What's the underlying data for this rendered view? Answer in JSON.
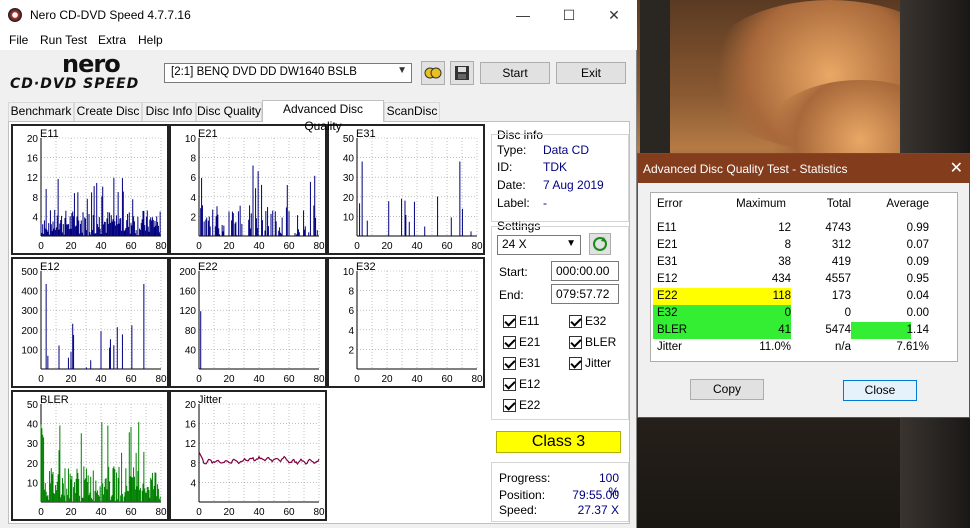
{
  "window": {
    "title": "Nero CD-DVD Speed 4.7.7.16",
    "minimize": "—",
    "maximize": "☐",
    "close": "✕"
  },
  "menu": [
    "File",
    "Run Test",
    "Extra",
    "Help"
  ],
  "logo": {
    "line1": "nero",
    "line2": "CD·DVD SPEED"
  },
  "toolbar": {
    "drive": "[2:1]   BENQ DVD DD DW1640 BSLB",
    "start": "Start",
    "exit": "Exit"
  },
  "tabs": [
    "Benchmark",
    "Create Disc",
    "Disc Info",
    "Disc Quality",
    "Advanced Disc Quality",
    "ScanDisc"
  ],
  "active_tab": "Advanced Disc Quality",
  "disc_info": {
    "header": "Disc info",
    "type_label": "Type:",
    "type": "Data CD",
    "id_label": "ID:",
    "id": "TDK",
    "date_label": "Date:",
    "date": "7 Aug 2019",
    "label_label": "Label:",
    "label": "-"
  },
  "settings": {
    "header": "Settings",
    "speed": "24 X",
    "start_label": "Start:",
    "start": "000:00.00",
    "end_label": "End:",
    "end": "079:57.72"
  },
  "checks": {
    "e11": "E11",
    "e21": "E21",
    "e31": "E31",
    "e12": "E12",
    "e22": "E22",
    "e32": "E32",
    "bler": "BLER",
    "jitter": "Jitter"
  },
  "class": "Class 3",
  "progress": {
    "progress_label": "Progress:",
    "progress": "100 %",
    "position_label": "Position:",
    "position": "79:55.00",
    "speed_label": "Speed:",
    "speed": "27.37 X"
  },
  "colors": {
    "e_series": "#000080",
    "e32_series": "#000080",
    "bler": "#008000",
    "jitter": "#800040",
    "highlight_yellow": "#ffff00",
    "highlight_green": "#33ee33"
  },
  "chart_data": [
    {
      "type": "bar",
      "name": "E11",
      "x": [
        0,
        20,
        40,
        60,
        80
      ],
      "yticks": [
        4,
        8,
        12,
        16,
        20
      ],
      "ylim": [
        0,
        20
      ],
      "color": "#000080",
      "shape": "dense_noise",
      "max": 12
    },
    {
      "type": "bar",
      "name": "E21",
      "x": [
        0,
        20,
        40,
        60,
        80
      ],
      "yticks": [
        2,
        4,
        6,
        8,
        10
      ],
      "ylim": [
        0,
        10
      ],
      "color": "#000080",
      "shape": "sparse",
      "max": 8
    },
    {
      "type": "bar",
      "name": "E31",
      "x": [
        0,
        20,
        40,
        60,
        80
      ],
      "yticks": [
        10,
        20,
        30,
        40,
        50
      ],
      "ylim": [
        0,
        50
      ],
      "color": "#000080",
      "shape": "rare",
      "max": 38
    },
    {
      "type": "bar",
      "name": "E12",
      "x": [
        0,
        20,
        40,
        60,
        80
      ],
      "yticks": [
        100,
        200,
        300,
        400,
        500
      ],
      "ylim": [
        0,
        500
      ],
      "color": "#000080",
      "shape": "rare",
      "max": 434
    },
    {
      "type": "bar",
      "name": "E22",
      "x": [
        0,
        20,
        40,
        60,
        80
      ],
      "yticks": [
        40,
        80,
        120,
        160,
        200
      ],
      "ylim": [
        0,
        200
      ],
      "color": "#000080",
      "shape": "single",
      "max": 118
    },
    {
      "type": "bar",
      "name": "E32",
      "x": [
        0,
        20,
        40,
        60,
        80
      ],
      "yticks": [
        2,
        4,
        6,
        8,
        10
      ],
      "ylim": [
        0,
        10
      ],
      "color": "#000080",
      "shape": "none",
      "max": 0
    },
    {
      "type": "bar",
      "name": "BLER",
      "x": [
        0,
        20,
        40,
        60,
        80
      ],
      "yticks": [
        10,
        20,
        30,
        40,
        50
      ],
      "ylim": [
        0,
        50
      ],
      "color": "#008000",
      "shape": "dense_noise",
      "max": 41
    },
    {
      "type": "line",
      "name": "Jitter",
      "x": [
        0,
        20,
        40,
        60,
        80
      ],
      "yticks": [
        4,
        8,
        12,
        16,
        20
      ],
      "ylim": [
        0,
        20
      ],
      "color": "#800040",
      "shape": "jitter",
      "max": 11.0
    }
  ],
  "stats": {
    "title": "Advanced Disc Quality Test - Statistics",
    "close_x": "✕",
    "headers": [
      "Error",
      "Maximum",
      "Total",
      "Average"
    ],
    "rows": [
      [
        "E11",
        "12",
        "4743",
        "0.99"
      ],
      [
        "E21",
        "8",
        "312",
        "0.07"
      ],
      [
        "E31",
        "38",
        "419",
        "0.09"
      ],
      [
        "E12",
        "434",
        "4557",
        "0.95"
      ],
      [
        "E22",
        "118",
        "173",
        "0.04"
      ],
      [
        "E32",
        "0",
        "0",
        "0.00"
      ],
      [
        "BLER",
        "41",
        "5474",
        "1.14"
      ],
      [
        "Jitter",
        "11.0%",
        "n/a",
        "7.61%"
      ]
    ],
    "copy": "Copy",
    "close": "Close"
  }
}
